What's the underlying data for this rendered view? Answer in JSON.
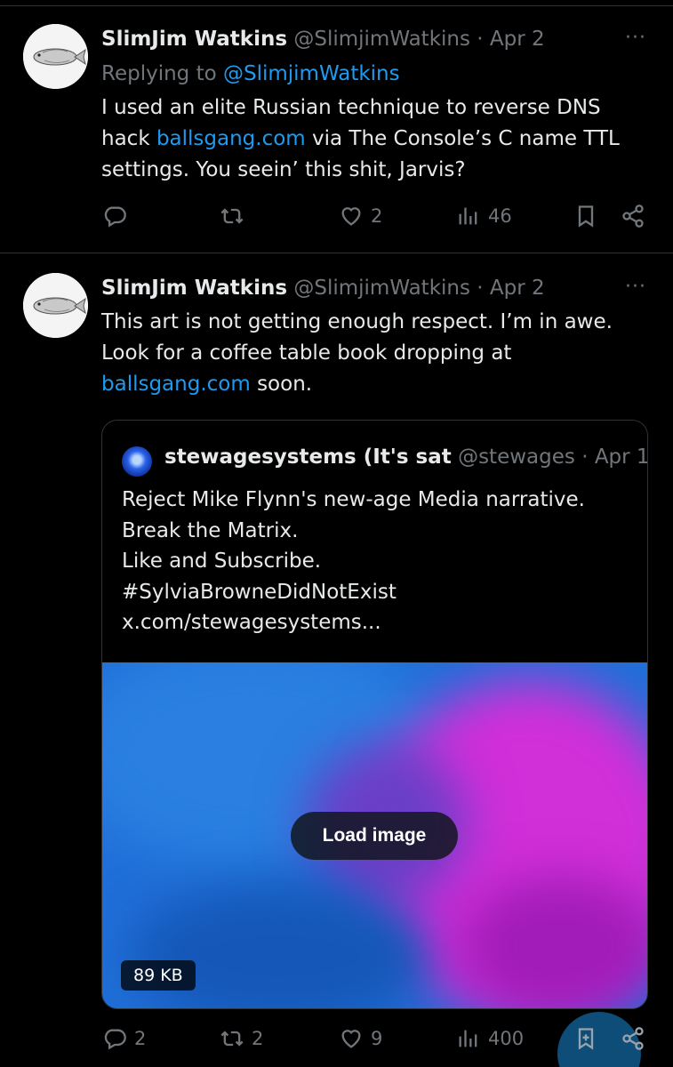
{
  "tweets": [
    {
      "author": "SlimJim Watkins",
      "handle": "@SlimjimWatkins",
      "separator": "·",
      "date": "Apr 2",
      "replying_label": "Replying to",
      "replying_handle": "@SlimjimWatkins",
      "text_before_link": "I used an elite Russian technique to reverse DNS hack ",
      "link": "ballsgang.com",
      "text_after_link": " via The Console’s C name TTL settings. You seein’ this shit, Jarvis?",
      "replies": "",
      "reposts": "",
      "likes": "2",
      "views": "46"
    },
    {
      "author": "SlimJim Watkins",
      "handle": "@SlimjimWatkins",
      "separator": "·",
      "date": "Apr 2",
      "text_before_link": "This art is not getting enough respect. I’m in awe. Look for a coffee table book dropping at ",
      "link": "ballsgang.com",
      "text_after_link": " soon.",
      "replies": "2",
      "reposts": "2",
      "likes": "9",
      "views": "400"
    }
  ],
  "quote": {
    "author": "stewagesystems (It's sat",
    "handle": "@stewages",
    "separator": "·",
    "date": "Apr 1",
    "lines": [
      "Reject Mike Flynn's new-age Media narrative.",
      "Break the Matrix.",
      "Like and Subscribe.",
      "#SylviaBrowneDidNotExist",
      "x.com/stewagesystems..."
    ],
    "load_image_label": "Load image",
    "size_badge": "89 KB"
  },
  "more_glyph": "···",
  "colors": {
    "background": "#000000",
    "link": "#1d9bf0",
    "muted": "#71767b",
    "text": "#e7e9ea",
    "accent": "#1a8cd8"
  },
  "icons": [
    "reply-icon",
    "repost-icon",
    "like-icon",
    "views-icon",
    "bookmark-icon",
    "share-icon",
    "more-icon",
    "compose-icon"
  ]
}
